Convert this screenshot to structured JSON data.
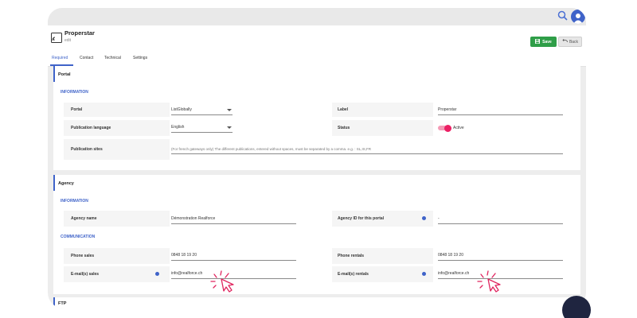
{
  "header": {
    "title": "Properstar",
    "subtitle": "edit",
    "save_label": "Save",
    "back_label": "Back"
  },
  "tabs": [
    {
      "label": "Required"
    },
    {
      "label": "Contact"
    },
    {
      "label": "Technical"
    },
    {
      "label": "Settings"
    }
  ],
  "portal": {
    "section_title": "Portal",
    "group_information": "INFORMATION",
    "portal_label": "Portal",
    "portal_value": "ListGlobally",
    "label_label": "Label",
    "label_value": "Properstar",
    "language_label": "Publication language",
    "language_value": "English",
    "status_label": "Status",
    "status_value": "Active",
    "sites_label": "Publication sites",
    "sites_placeholder": "(For french gateways only) The different publications, entered without spaces, must be separated by a comma. e.g. : SL,IS,FR"
  },
  "agency": {
    "section_title": "Agency",
    "group_information": "INFORMATION",
    "name_label": "Agency name",
    "name_value": "Démonstration Realforce",
    "id_label": "Agency ID for this portal",
    "id_value": "-",
    "group_communication": "COMMUNICATION",
    "phone_sales_label": "Phone sales",
    "phone_sales_value": "0848 18 19 20",
    "phone_rentals_label": "Phone rentals",
    "phone_rentals_value": "0848 18 19 20",
    "email_sales_label": "E-mail(s) sales",
    "email_sales_value": "info@realforce.ch",
    "email_rentals_label": "E-mail(s) rentals",
    "email_rentals_value": "info@realforce.ch"
  },
  "ftp": {
    "section_title": "FTP"
  },
  "colors": {
    "accent": "#3f63c9",
    "save": "#2f9e48",
    "toggle": "#ec1f64",
    "cursor": "#e0245e"
  }
}
